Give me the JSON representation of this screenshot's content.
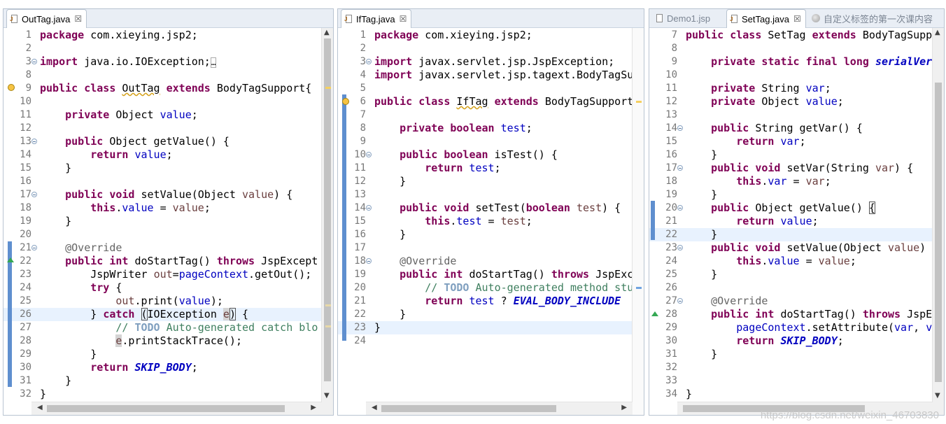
{
  "panes": [
    {
      "tabs": [
        {
          "title": "OutTag.java",
          "close": "☒",
          "active": true
        }
      ],
      "lines": [
        {
          "n": "1",
          "html": "<span class='k'>package</span> com.xieying.jsp2;"
        },
        {
          "n": "2",
          "html": ""
        },
        {
          "n": "3",
          "html": "<span class='k'>import</span> java.io.IOException;<span style='border:1px solid #aaa;font-size:11px'>&#8230;</span>",
          "fold": true
        },
        {
          "n": "8",
          "html": ""
        },
        {
          "n": "9",
          "html": "<span class='k'>public</span> <span class='k'>class</span> <span class='squig'>OutTag</span> <span class='k'>extends</span> BodyTagSupport{"
        },
        {
          "n": "10",
          "html": ""
        },
        {
          "n": "11",
          "html": "    <span class='k'>private</span> Object <span class='f'>value</span>;"
        },
        {
          "n": "12",
          "html": ""
        },
        {
          "n": "13",
          "html": "    <span class='k'>public</span> Object getValue() {",
          "fold": true
        },
        {
          "n": "14",
          "html": "        <span class='k'>return</span> <span class='f'>value</span>;"
        },
        {
          "n": "15",
          "html": "    }"
        },
        {
          "n": "16",
          "html": ""
        },
        {
          "n": "17",
          "html": "    <span class='k'>public</span> <span class='k'>void</span> setValue(Object <span class='lv'>value</span>) {",
          "fold": true
        },
        {
          "n": "18",
          "html": "        <span class='k'>this</span>.<span class='f'>value</span> = <span class='lv'>value</span>;"
        },
        {
          "n": "19",
          "html": "    }"
        },
        {
          "n": "20",
          "html": ""
        },
        {
          "n": "21",
          "html": "    <span class='an'>@Override</span>",
          "fold": true
        },
        {
          "n": "22",
          "html": "    <span class='k'>public</span> <span class='k'>int</span> doStartTag() <span class='k'>throws</span> JspExcept"
        },
        {
          "n": "23",
          "html": "        JspWriter <span class='lv'>out</span>=<span class='f'>pageContext</span>.getOut();"
        },
        {
          "n": "24",
          "html": "        <span class='k'>try</span> {"
        },
        {
          "n": "25",
          "html": "            <span class='lv'>out</span>.print(<span class='f'>value</span>);"
        },
        {
          "n": "26",
          "html": "        } <span class='k'>catch</span> <span class='selbox'>(</span>IOException <span class='occur lv'>e</span><span class='selbox'>)</span> {",
          "hl": true
        },
        {
          "n": "27",
          "html": "            <span class='cm'>// <span class='td'>TODO</span> Auto-generated catch blo</span>"
        },
        {
          "n": "28",
          "html": "            <span class='occur lv'>e</span>.printStackTrace();"
        },
        {
          "n": "29",
          "html": "        }"
        },
        {
          "n": "30",
          "html": "        <span class='k'>return</span> <span class='sc'>SKIP_BODY</span>;"
        },
        {
          "n": "31",
          "html": "    }"
        },
        {
          "n": "32",
          "html": "}"
        }
      ]
    },
    {
      "tabs": [
        {
          "title": "IfTag.java",
          "close": "☒",
          "active": true
        }
      ],
      "lines": [
        {
          "n": "1",
          "html": "<span class='k'>package</span> com.xieying.jsp2;"
        },
        {
          "n": "2",
          "html": ""
        },
        {
          "n": "3",
          "html": "<span class='k'>import</span> javax.servlet.jsp.JspException;",
          "fold": true
        },
        {
          "n": "4",
          "html": "<span class='k'>import</span> javax.servlet.jsp.tagext.BodyTagSu"
        },
        {
          "n": "5",
          "html": ""
        },
        {
          "n": "6",
          "html": "<span class='k'>public</span> <span class='k'>class</span> <span class='squig'>IfTag</span> <span class='k'>extends</span> BodyTagSupport"
        },
        {
          "n": "7",
          "html": ""
        },
        {
          "n": "8",
          "html": "    <span class='k'>private</span> <span class='k'>boolean</span> <span class='f'>test</span>;"
        },
        {
          "n": "9",
          "html": ""
        },
        {
          "n": "10",
          "html": "    <span class='k'>public</span> <span class='k'>boolean</span> isTest() {",
          "fold": true
        },
        {
          "n": "11",
          "html": "        <span class='k'>return</span> <span class='f'>test</span>;"
        },
        {
          "n": "12",
          "html": "    }"
        },
        {
          "n": "13",
          "html": ""
        },
        {
          "n": "14",
          "html": "    <span class='k'>public</span> <span class='k'>void</span> setTest(<span class='k'>boolean</span> <span class='lv'>test</span>) {",
          "fold": true
        },
        {
          "n": "15",
          "html": "        <span class='k'>this</span>.<span class='f'>test</span> = <span class='lv'>test</span>;"
        },
        {
          "n": "16",
          "html": "    }"
        },
        {
          "n": "17",
          "html": ""
        },
        {
          "n": "18",
          "html": "    <span class='an'>@Override</span>",
          "fold": true
        },
        {
          "n": "19",
          "html": "    <span class='k'>public</span> <span class='k'>int</span> doStartTag() <span class='k'>throws</span> JspExc"
        },
        {
          "n": "20",
          "html": "        <span class='cm'>// <span class='td'>TODO</span> Auto-generated method stu</span>"
        },
        {
          "n": "21",
          "html": "        <span class='k'>return</span> <span class='f'>test</span> ? <span class='sc'>EVAL_BODY_INCLUDE</span>"
        },
        {
          "n": "22",
          "html": "    }"
        },
        {
          "n": "23",
          "html": "}",
          "hl": true
        },
        {
          "n": "24",
          "html": ""
        }
      ]
    },
    {
      "tabs": [
        {
          "title": "Demo1.jsp",
          "close": "",
          "active": false
        },
        {
          "title": "SetTag.java",
          "close": "☒",
          "active": true
        },
        {
          "title": "自定义标签的第一次课内容",
          "close": "",
          "active": false
        }
      ],
      "lines": [
        {
          "n": "7",
          "html": "<span class='k'>public</span> <span class='k'>class</span> SetTag <span class='k'>extends</span> BodyTagSuppo"
        },
        {
          "n": "8",
          "html": ""
        },
        {
          "n": "9",
          "html": "    <span class='k'>private</span> <span class='k'>static</span> <span class='k'>final</span> <span class='k'>long</span> <span class='sc'>serialVers</span>"
        },
        {
          "n": "10",
          "html": ""
        },
        {
          "n": "11",
          "html": "    <span class='k'>private</span> String <span class='f'>var</span>;"
        },
        {
          "n": "12",
          "html": "    <span class='k'>private</span> Object <span class='f'>value</span>;"
        },
        {
          "n": "13",
          "html": ""
        },
        {
          "n": "14",
          "html": "    <span class='k'>public</span> String getVar() {",
          "fold": true
        },
        {
          "n": "15",
          "html": "        <span class='k'>return</span> <span class='f'>var</span>;"
        },
        {
          "n": "16",
          "html": "    }"
        },
        {
          "n": "17",
          "html": "    <span class='k'>public</span> <span class='k'>void</span> setVar(String <span class='lv'>var</span>) {",
          "fold": true
        },
        {
          "n": "18",
          "html": "        <span class='k'>this</span>.<span class='f'>var</span> = <span class='lv'>var</span>;"
        },
        {
          "n": "19",
          "html": "    }"
        },
        {
          "n": "20",
          "html": "    <span class='k'>public</span> Object getValue() <span class='selbox'>{</span>",
          "fold": true
        },
        {
          "n": "21",
          "html": "        <span class='k'>return</span> <span class='f'>value</span>;"
        },
        {
          "n": "22",
          "html": "    }",
          "hl": true
        },
        {
          "n": "23",
          "html": "    <span class='k'>public</span> <span class='k'>void</span> setValue(Object <span class='lv'>value</span>) {",
          "fold": true
        },
        {
          "n": "24",
          "html": "        <span class='k'>this</span>.<span class='f'>value</span> = <span class='lv'>value</span>;"
        },
        {
          "n": "25",
          "html": "    }"
        },
        {
          "n": "26",
          "html": ""
        },
        {
          "n": "27",
          "html": "    <span class='an'>@Override</span>",
          "fold": true
        },
        {
          "n": "28",
          "html": "    <span class='k'>public</span> <span class='k'>int</span> doStartTag() <span class='k'>throws</span> JspExc"
        },
        {
          "n": "29",
          "html": "        <span class='f'>pageContext</span>.setAttribute(<span class='f'>var</span>, <span class='f'>va</span>"
        },
        {
          "n": "30",
          "html": "        <span class='k'>return</span> <span class='sc'>SKIP_BODY</span>;"
        },
        {
          "n": "31",
          "html": "    }"
        },
        {
          "n": "32",
          "html": ""
        },
        {
          "n": "33",
          "html": ""
        },
        {
          "n": "34",
          "html": "}"
        }
      ]
    }
  ],
  "watermark": "https://blog.csdn.net/weixin_46703830"
}
